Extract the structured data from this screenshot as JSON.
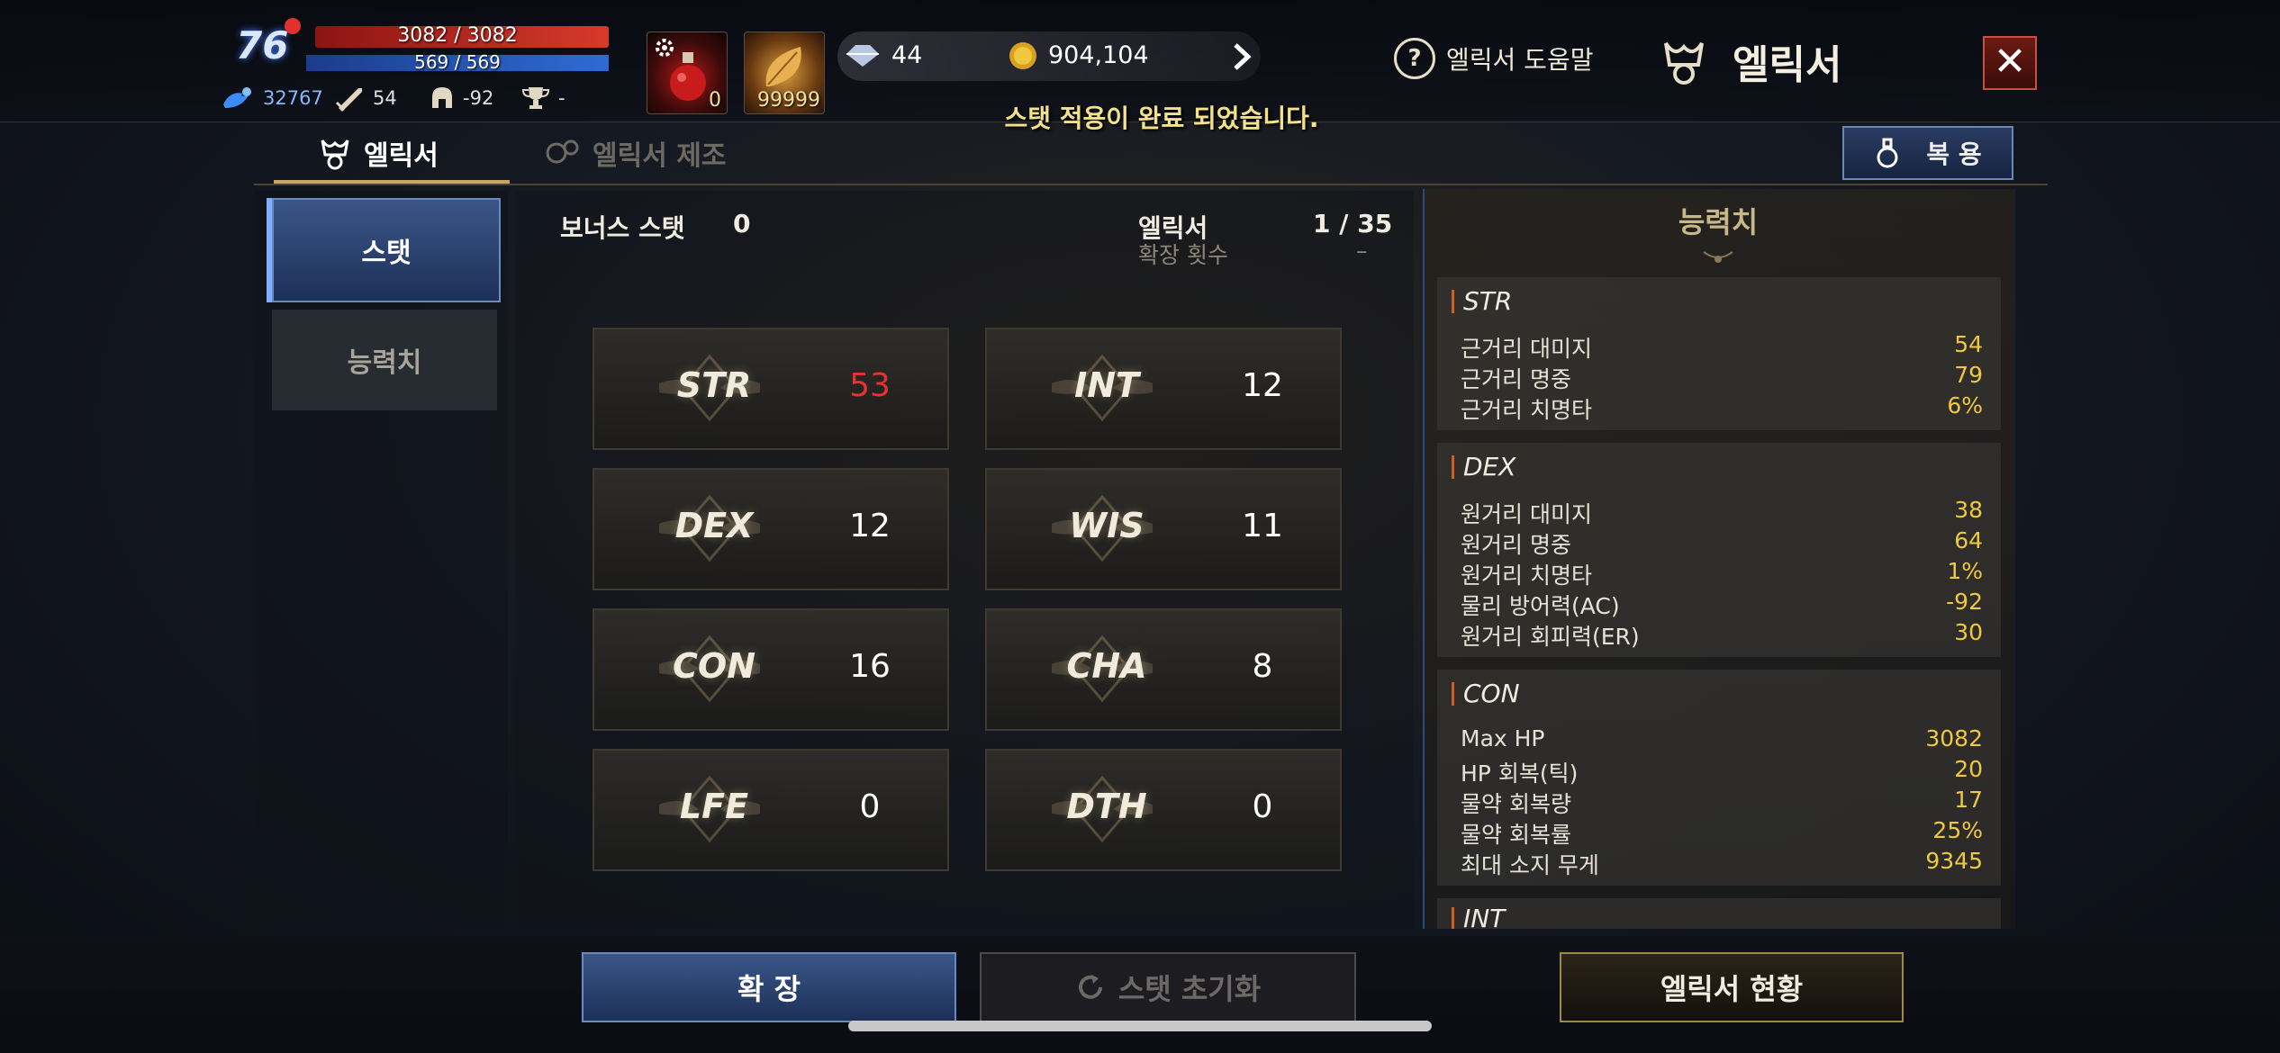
{
  "player": {
    "level": "76",
    "hp": "3082 / 3082",
    "mp": "569 / 569",
    "stats": [
      {
        "icon": "spirit-icon",
        "value": "32767"
      },
      {
        "icon": "sword-icon",
        "value": "54"
      },
      {
        "icon": "helmet-icon",
        "value": "-92"
      },
      {
        "icon": "trophy-icon",
        "value": "-"
      }
    ]
  },
  "quickslots": [
    {
      "icon": "potion-icon",
      "count": "0"
    },
    {
      "icon": "leaf-icon",
      "count": "99999"
    }
  ],
  "currency": {
    "diamond": "44",
    "gold": "904,104"
  },
  "notice": "스탯 적용이 완료 되었습니다.",
  "header": {
    "help_label": "엘릭서 도움말",
    "title": "엘릭서"
  },
  "tabs": [
    {
      "label": "엘릭서",
      "active": true
    },
    {
      "label": "엘릭서 제조",
      "active": false
    }
  ],
  "use_button": "복 용",
  "side_tabs": [
    {
      "label": "스탯",
      "active": true
    },
    {
      "label": "능력치",
      "active": false
    }
  ],
  "center": {
    "bonus_label": "보너스 스탯",
    "bonus_value": "0",
    "elixir_label": "엘릭서",
    "elixir_value": "1 / 35",
    "expand_label": "확장 횟수",
    "expand_value": "–"
  },
  "stat_cards": [
    {
      "name": "STR",
      "value": "53",
      "highlight": true
    },
    {
      "name": "INT",
      "value": "12"
    },
    {
      "name": "DEX",
      "value": "12"
    },
    {
      "name": "WIS",
      "value": "11"
    },
    {
      "name": "CON",
      "value": "16"
    },
    {
      "name": "CHA",
      "value": "8"
    },
    {
      "name": "LFE",
      "value": "0"
    },
    {
      "name": "DTH",
      "value": "0"
    }
  ],
  "abilities": {
    "title": "능력치",
    "sections": [
      {
        "name": "STR",
        "rows": [
          {
            "label": "근거리 대미지",
            "value": "54"
          },
          {
            "label": "근거리 명중",
            "value": "79"
          },
          {
            "label": "근거리 치명타",
            "value": "6%"
          }
        ]
      },
      {
        "name": "DEX",
        "rows": [
          {
            "label": "원거리 대미지",
            "value": "38"
          },
          {
            "label": "원거리 명중",
            "value": "64"
          },
          {
            "label": "원거리 치명타",
            "value": "1%"
          },
          {
            "label": "물리 방어력(AC)",
            "value": "-92"
          },
          {
            "label": "원거리 회피력(ER)",
            "value": "30"
          }
        ]
      },
      {
        "name": "CON",
        "rows": [
          {
            "label": "Max HP",
            "value": "3082"
          },
          {
            "label": "HP 회복(틱)",
            "value": "20"
          },
          {
            "label": "물약 회복량",
            "value": "17"
          },
          {
            "label": "물약 회복률",
            "value": "25%"
          },
          {
            "label": "최대 소지 무게",
            "value": "9345"
          }
        ]
      },
      {
        "name": "INT",
        "rows": []
      }
    ]
  },
  "bottom_buttons": {
    "expand": "확 장",
    "reset": "스탯 초기화",
    "status": "엘릭서 현황"
  },
  "colors": {
    "accent_blue": "#3a5688",
    "gold_value": "#f0c840",
    "highlight_red": "#e83030",
    "notice_yellow": "#f4e28a"
  }
}
